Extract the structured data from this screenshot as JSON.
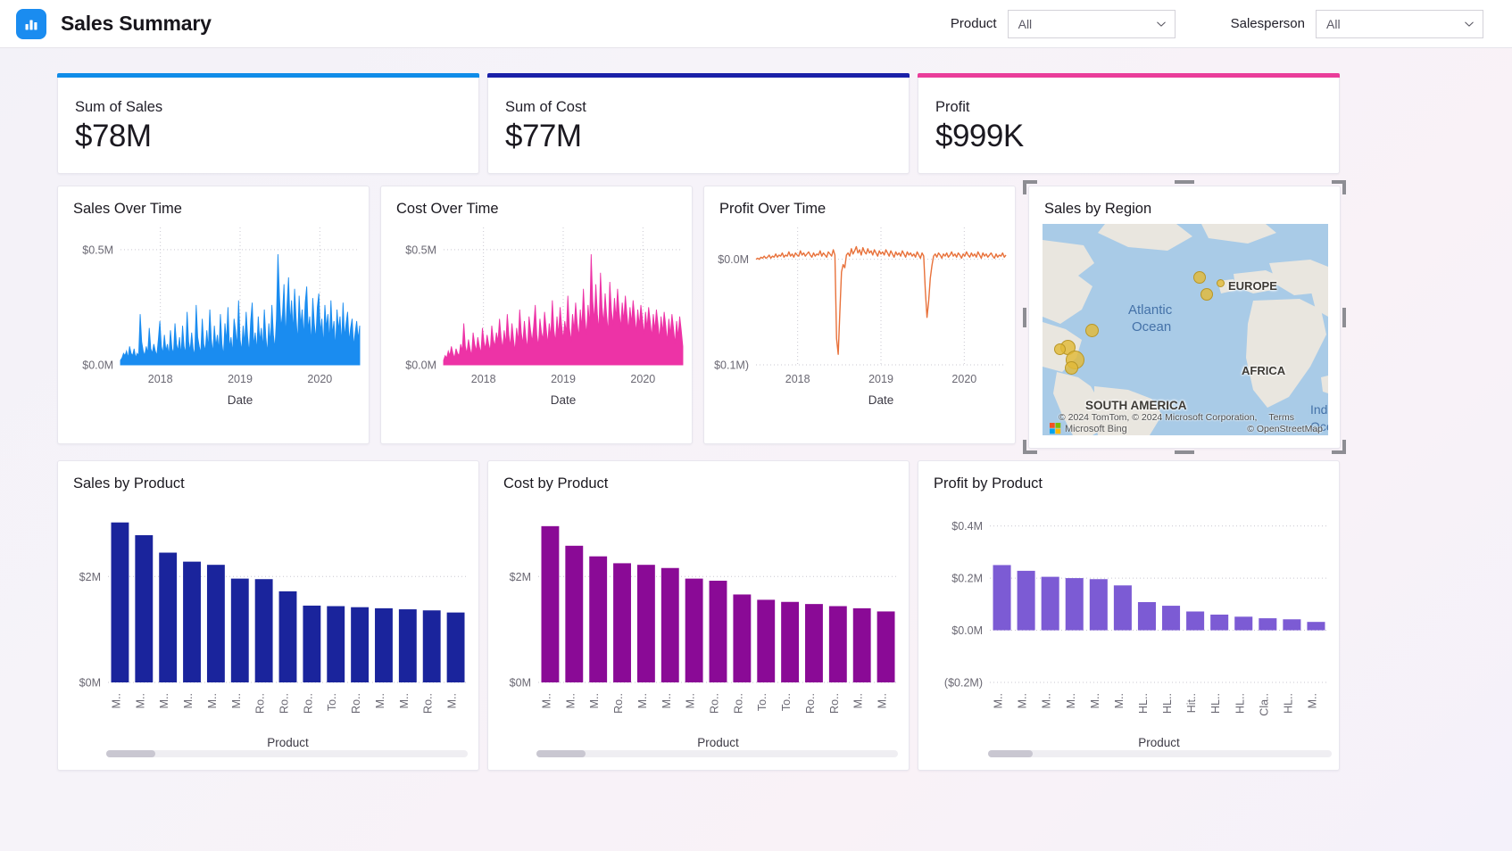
{
  "header": {
    "logo_icon": "bar-chart-icon",
    "title": "Sales Summary",
    "filters": [
      {
        "label": "Product",
        "value": "All",
        "icon": "chevron-down-icon"
      },
      {
        "label": "Salesperson",
        "value": "All",
        "icon": "chevron-down-icon"
      }
    ]
  },
  "kpis": [
    {
      "label": "Sum of Sales",
      "value": "$78M",
      "accent": "#0f8ce8"
    },
    {
      "label": "Sum of Cost",
      "value": "$77M",
      "accent": "#1a20a8"
    },
    {
      "label": "Profit",
      "value": "$999K",
      "accent": "#ea3d9a"
    }
  ],
  "map": {
    "title": "Sales by Region",
    "selected": true,
    "labels": [
      {
        "text": "EUROPE",
        "kind": "continent"
      },
      {
        "text": "AFRICA",
        "kind": "continent"
      },
      {
        "text": "SOUTH AMERICA",
        "kind": "continent"
      },
      {
        "text": "Atlantic",
        "kind": "ocean"
      },
      {
        "text": "Ocean",
        "kind": "ocean"
      },
      {
        "text": "India",
        "kind": "ocean"
      },
      {
        "text": "Ocea",
        "kind": "ocean"
      }
    ],
    "attribution": "© 2024 TomTom, © 2024 Microsoft Corporation,",
    "terms": "Terms",
    "provider": "Microsoft Bing",
    "osm": "© OpenStreetMap"
  },
  "chart_data": [
    {
      "id": "sales-over-time",
      "type": "area",
      "title": "Sales Over Time",
      "xlabel": "Date",
      "ylabel": "",
      "color": "#1a8cf0",
      "ytick_labels": [
        "$0.5M",
        "$0.0M"
      ],
      "ylim": [
        0,
        0.55
      ],
      "xtick_labels": [
        "2018",
        "2019",
        "2020"
      ],
      "grid": true,
      "values": [
        0.02,
        0.03,
        0.05,
        0.04,
        0.06,
        0.03,
        0.08,
        0.05,
        0.04,
        0.07,
        0.03,
        0.05,
        0.04,
        0.22,
        0.1,
        0.06,
        0.04,
        0.08,
        0.05,
        0.16,
        0.07,
        0.05,
        0.09,
        0.06,
        0.04,
        0.11,
        0.19,
        0.08,
        0.05,
        0.13,
        0.06,
        0.09,
        0.04,
        0.15,
        0.07,
        0.05,
        0.18,
        0.09,
        0.06,
        0.12,
        0.04,
        0.17,
        0.08,
        0.05,
        0.23,
        0.1,
        0.06,
        0.14,
        0.07,
        0.04,
        0.26,
        0.12,
        0.08,
        0.05,
        0.2,
        0.09,
        0.06,
        0.15,
        0.07,
        0.24,
        0.11,
        0.05,
        0.17,
        0.08,
        0.13,
        0.06,
        0.22,
        0.09,
        0.04,
        0.18,
        0.1,
        0.25,
        0.07,
        0.12,
        0.05,
        0.2,
        0.15,
        0.08,
        0.28,
        0.11,
        0.06,
        0.17,
        0.09,
        0.23,
        0.12,
        0.05,
        0.19,
        0.27,
        0.08,
        0.14,
        0.06,
        0.21,
        0.1,
        0.16,
        0.07,
        0.24,
        0.12,
        0.05,
        0.18,
        0.09,
        0.26,
        0.13,
        0.07,
        0.2,
        0.48,
        0.3,
        0.16,
        0.22,
        0.35,
        0.12,
        0.26,
        0.38,
        0.18,
        0.28,
        0.14,
        0.33,
        0.2,
        0.1,
        0.3,
        0.17,
        0.24,
        0.12,
        0.27,
        0.34,
        0.15,
        0.21,
        0.09,
        0.29,
        0.18,
        0.11,
        0.25,
        0.31,
        0.14,
        0.2,
        0.08,
        0.26,
        0.16,
        0.22,
        0.1,
        0.28,
        0.13,
        0.19,
        0.07,
        0.24,
        0.15,
        0.21,
        0.09,
        0.27,
        0.12,
        0.18,
        0.23,
        0.1,
        0.16,
        0.2,
        0.08,
        0.14,
        0.19,
        0.11,
        0.17
      ]
    },
    {
      "id": "cost-over-time",
      "type": "area",
      "title": "Cost Over Time",
      "xlabel": "Date",
      "ylabel": "",
      "color": "#ed33a6",
      "ytick_labels": [
        "$0.5M",
        "$0.0M"
      ],
      "ylim": [
        0,
        0.55
      ],
      "xtick_labels": [
        "2018",
        "2019",
        "2020"
      ],
      "grid": true,
      "values": [
        0.02,
        0.04,
        0.03,
        0.06,
        0.04,
        0.08,
        0.05,
        0.03,
        0.07,
        0.05,
        0.04,
        0.09,
        0.06,
        0.18,
        0.08,
        0.05,
        0.11,
        0.07,
        0.04,
        0.14,
        0.09,
        0.06,
        0.12,
        0.08,
        0.05,
        0.16,
        0.1,
        0.07,
        0.13,
        0.09,
        0.06,
        0.17,
        0.11,
        0.08,
        0.14,
        0.1,
        0.2,
        0.12,
        0.07,
        0.15,
        0.09,
        0.22,
        0.13,
        0.08,
        0.18,
        0.11,
        0.06,
        0.16,
        0.1,
        0.24,
        0.14,
        0.09,
        0.19,
        0.12,
        0.07,
        0.21,
        0.15,
        0.1,
        0.17,
        0.26,
        0.13,
        0.08,
        0.2,
        0.14,
        0.11,
        0.23,
        0.16,
        0.09,
        0.18,
        0.12,
        0.28,
        0.15,
        0.1,
        0.21,
        0.13,
        0.25,
        0.17,
        0.11,
        0.19,
        0.14,
        0.3,
        0.16,
        0.1,
        0.22,
        0.15,
        0.27,
        0.18,
        0.12,
        0.24,
        0.16,
        0.33,
        0.2,
        0.13,
        0.26,
        0.17,
        0.48,
        0.28,
        0.19,
        0.35,
        0.22,
        0.15,
        0.4,
        0.25,
        0.18,
        0.31,
        0.21,
        0.14,
        0.36,
        0.24,
        0.17,
        0.29,
        0.2,
        0.33,
        0.23,
        0.16,
        0.27,
        0.19,
        0.3,
        0.22,
        0.15,
        0.25,
        0.18,
        0.28,
        0.21,
        0.14,
        0.24,
        0.17,
        0.26,
        0.2,
        0.13,
        0.23,
        0.16,
        0.25,
        0.19,
        0.12,
        0.22,
        0.15,
        0.24,
        0.18,
        0.11,
        0.21,
        0.14,
        0.23,
        0.17,
        0.1,
        0.2,
        0.13,
        0.22,
        0.16,
        0.09,
        0.19,
        0.12,
        0.21,
        0.15,
        0.08
      ]
    },
    {
      "id": "profit-over-time",
      "type": "line",
      "title": "Profit Over Time",
      "xlabel": "Date",
      "ylabel": "",
      "color": "#e8713a",
      "ytick_labels": [
        "$0.0M",
        "$0.1M)"
      ],
      "ylim": [
        -0.1,
        0.02
      ],
      "xtick_labels": [
        "2018",
        "2019",
        "2020"
      ],
      "grid": true,
      "values": [
        0.0,
        0.001,
        0.0,
        0.002,
        0.001,
        0.003,
        0.001,
        0.002,
        0.004,
        0.001,
        0.003,
        0.002,
        0.005,
        0.002,
        0.004,
        0.003,
        0.006,
        0.002,
        0.004,
        0.003,
        0.007,
        0.003,
        0.005,
        0.002,
        0.006,
        0.004,
        0.003,
        0.008,
        0.004,
        0.006,
        0.003,
        0.005,
        0.007,
        0.004,
        0.002,
        0.006,
        0.003,
        0.005,
        0.004,
        0.008,
        0.003,
        0.006,
        0.004,
        0.002,
        0.007,
        0.005,
        0.003,
        0.009,
        0.004,
        -0.075,
        -0.09,
        -0.05,
        -0.012,
        -0.005,
        -0.008,
        0.004,
        0.006,
        0.003,
        0.01,
        0.005,
        0.008,
        0.012,
        0.006,
        0.009,
        0.004,
        0.011,
        0.007,
        0.005,
        0.01,
        0.006,
        0.008,
        0.004,
        0.009,
        0.006,
        0.003,
        0.008,
        0.005,
        0.007,
        0.004,
        0.009,
        0.006,
        0.003,
        0.008,
        0.005,
        0.002,
        0.007,
        0.004,
        0.006,
        0.003,
        0.008,
        0.005,
        0.002,
        0.007,
        0.004,
        0.006,
        0.003,
        0.005,
        0.002,
        0.007,
        0.004,
        0.001,
        0.006,
        0.003,
        -0.03,
        -0.055,
        -0.04,
        -0.018,
        -0.006,
        0.003,
        0.005,
        0.002,
        0.006,
        0.004,
        0.001,
        0.005,
        0.003,
        0.006,
        0.002,
        0.004,
        0.007,
        0.003,
        0.005,
        0.002,
        0.006,
        0.004,
        0.001,
        0.005,
        0.003,
        0.007,
        0.004,
        0.002,
        0.006,
        0.003,
        0.005,
        0.002,
        0.007,
        0.004,
        0.001,
        0.006,
        0.003,
        0.005,
        0.002,
        0.004,
        0.006,
        0.003,
        0.001,
        0.005,
        0.002,
        0.004,
        0.003,
        0.006,
        0.002,
        0.004
      ]
    },
    {
      "id": "sales-by-product",
      "type": "bar",
      "title": "Sales by Product",
      "xlabel": "Product",
      "ylabel": "",
      "color": "#1a249c",
      "ytick_labels": [
        "$2M",
        "$0M"
      ],
      "ylim": [
        0,
        3.2
      ],
      "categories": [
        "M..",
        "M..",
        "M..",
        "M..",
        "M..",
        "M..",
        "Ro..",
        "Ro..",
        "Ro..",
        "To..",
        "Ro..",
        "M..",
        "M..",
        "Ro..",
        "M.."
      ],
      "values": [
        3.02,
        2.78,
        2.45,
        2.28,
        2.22,
        1.96,
        1.95,
        1.72,
        1.45,
        1.44,
        1.42,
        1.4,
        1.38,
        1.36,
        1.32
      ]
    },
    {
      "id": "cost-by-product",
      "type": "bar",
      "title": "Cost by Product",
      "xlabel": "Product",
      "ylabel": "",
      "color": "#8a0a96",
      "ytick_labels": [
        "$2M",
        "$0M"
      ],
      "ylim": [
        0,
        3.2
      ],
      "categories": [
        "M..",
        "M..",
        "M..",
        "Ro..",
        "M..",
        "M..",
        "M..",
        "Ro..",
        "Ro..",
        "To..",
        "To..",
        "Ro..",
        "Ro..",
        "M..",
        "M.."
      ],
      "values": [
        2.95,
        2.58,
        2.38,
        2.25,
        2.22,
        2.16,
        1.96,
        1.92,
        1.66,
        1.56,
        1.52,
        1.48,
        1.44,
        1.4,
        1.34
      ]
    },
    {
      "id": "profit-by-product",
      "type": "bar",
      "title": "Profit by Product",
      "xlabel": "Product",
      "ylabel": "",
      "color": "#7c5bd4",
      "ytick_labels": [
        "$0.4M",
        "$0.2M",
        "$0.0M",
        "($0.2M)"
      ],
      "ylim": [
        -0.2,
        0.45
      ],
      "categories": [
        "M..",
        "M..",
        "M..",
        "M..",
        "M..",
        "M..",
        "HL..",
        "HL..",
        "Hit..",
        "HL..",
        "HL..",
        "Cla..",
        "HL..",
        "M.."
      ],
      "values": [
        0.25,
        0.228,
        0.205,
        0.2,
        0.196,
        0.172,
        0.108,
        0.094,
        0.072,
        0.06,
        0.052,
        0.046,
        0.042,
        0.032
      ]
    }
  ]
}
